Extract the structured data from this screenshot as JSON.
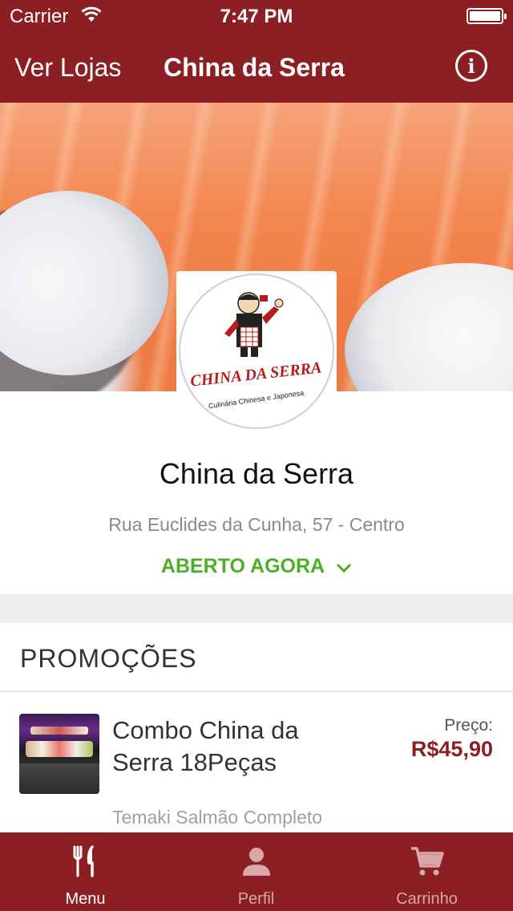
{
  "status_bar": {
    "carrier": "Carrier",
    "time": "7:47 PM"
  },
  "nav": {
    "back_label": "Ver Lojas",
    "title": "China da Serra",
    "info_icon": "info-circle-icon"
  },
  "hero": {
    "image": "salmon-sushi-photo"
  },
  "logo": {
    "brand_text": "CHINA DA SERRA",
    "tagline": "Culinária Chinesa e Japonesa"
  },
  "store": {
    "name": "China da Serra",
    "address": "Rua Euclides da Cunha, 57 - Centro",
    "status": "ABERTO AGORA"
  },
  "promotions": {
    "header": "PROMOÇÕES",
    "items": [
      {
        "name": "Combo China da Serra 18Peças",
        "price_label": "Preço:",
        "price": "R$45,90",
        "description": "Temaki Salmão Completo"
      }
    ]
  },
  "tab_bar": {
    "items": [
      {
        "label": "Menu",
        "icon": "fork-knife-icon",
        "active": true
      },
      {
        "label": "Perfil",
        "icon": "person-icon",
        "active": false
      },
      {
        "label": "Carrinho",
        "icon": "cart-icon",
        "active": false
      }
    ]
  },
  "colors": {
    "brand": "#8b1f24",
    "open_status": "#4caf26",
    "price": "#8b1f24"
  }
}
